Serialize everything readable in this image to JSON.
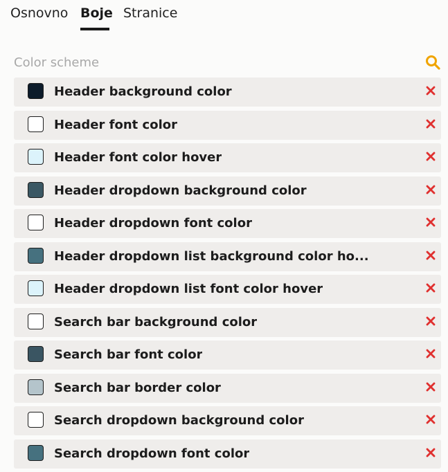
{
  "tabs": [
    {
      "label": "Osnovno",
      "active": false
    },
    {
      "label": "Boje",
      "active": true
    },
    {
      "label": "Stranice",
      "active": false
    }
  ],
  "search": {
    "placeholder": "Color scheme",
    "value": "",
    "icon": "search-icon",
    "icon_color": "#f0a400"
  },
  "remove_icon_color": "#e0302f",
  "colors": [
    {
      "label": "Header background color",
      "swatch": "#0c1b2a"
    },
    {
      "label": "Header font color",
      "swatch": "#ffffff"
    },
    {
      "label": "Header font color hover",
      "swatch": "#dcf3fb"
    },
    {
      "label": "Header dropdown background color",
      "swatch": "#3b5864"
    },
    {
      "label": "Header dropdown font color",
      "swatch": "#ffffff"
    },
    {
      "label": "Header dropdown list background color ho...",
      "swatch": "#46717f"
    },
    {
      "label": "Header dropdown list font color hover",
      "swatch": "#dcf3fb"
    },
    {
      "label": "Search bar background color",
      "swatch": "#ffffff"
    },
    {
      "label": "Search bar font color",
      "swatch": "#3a5562"
    },
    {
      "label": "Search bar border color",
      "swatch": "#b4c4cb"
    },
    {
      "label": "Search dropdown background color",
      "swatch": "#ffffff"
    },
    {
      "label": "Search dropdown font color",
      "swatch": "#46717f"
    }
  ]
}
